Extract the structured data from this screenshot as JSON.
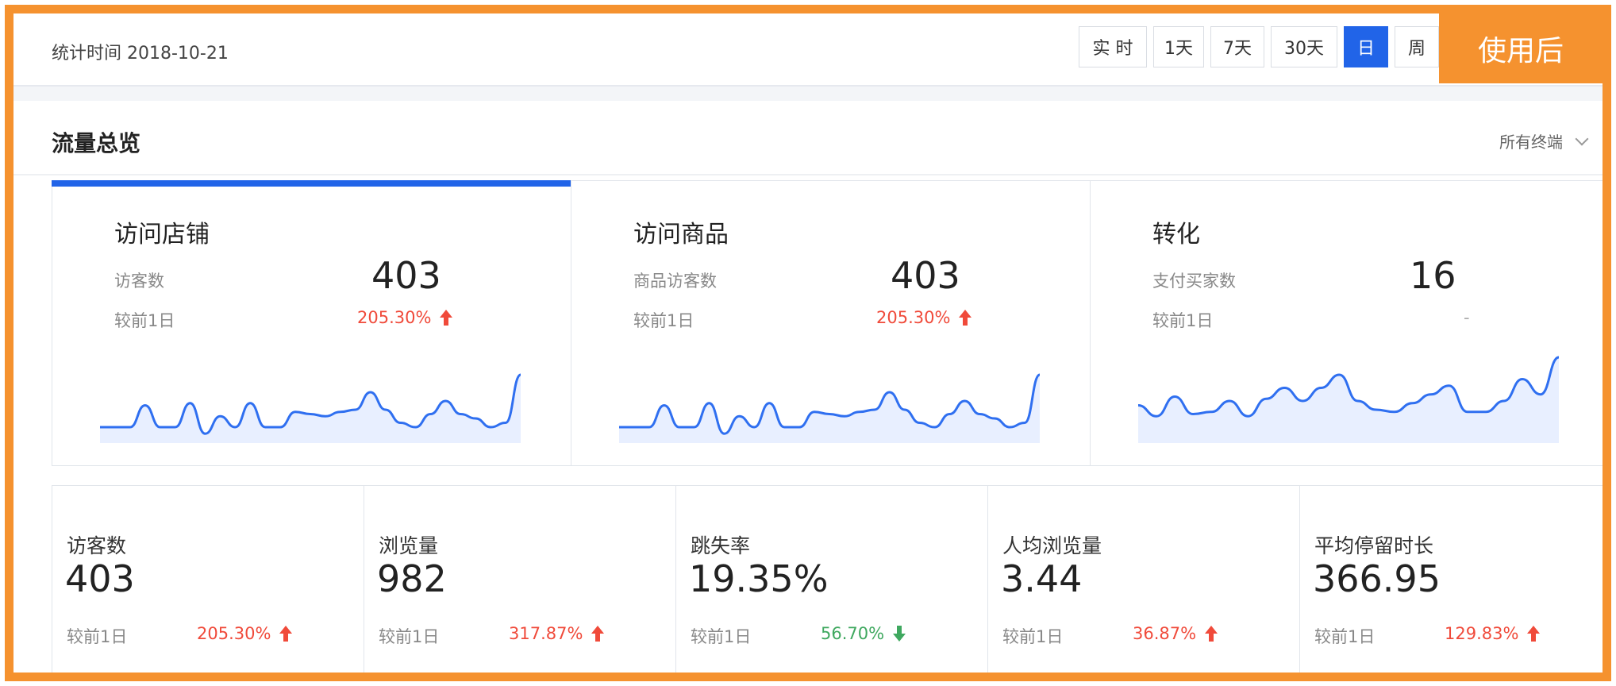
{
  "badge": "使用后",
  "header": {
    "stat_time": "统计时间 2018-10-21",
    "ranges": [
      {
        "label": "实 时",
        "active": false
      },
      {
        "label": "1天",
        "active": false
      },
      {
        "label": "7天",
        "active": false
      },
      {
        "label": "30天",
        "active": false
      },
      {
        "label": "日",
        "active": true
      },
      {
        "label": "周",
        "active": false
      }
    ]
  },
  "panel": {
    "title": "流量总览",
    "terminal_select": "所有终端"
  },
  "cards": [
    {
      "title": "访问店铺",
      "metric_label": "访客数",
      "metric_value": "403",
      "compare_label": "较前1日",
      "change": "205.30%",
      "trend": "up",
      "spark": [
        0,
        0,
        0,
        0.5,
        0,
        0,
        0.55,
        -0.15,
        0.25,
        0,
        0.55,
        0,
        0,
        0.35,
        0.3,
        0.25,
        0.35,
        0.4,
        0.8,
        0.4,
        0.1,
        0,
        0.3,
        0.6,
        0.3,
        0.2,
        0,
        0.1,
        1.2
      ]
    },
    {
      "title": "访问商品",
      "metric_label": "商品访客数",
      "metric_value": "403",
      "compare_label": "较前1日",
      "change": "205.30%",
      "trend": "up",
      "spark": [
        0,
        0,
        0,
        0.5,
        0,
        0,
        0.55,
        -0.15,
        0.25,
        0,
        0.55,
        0,
        0,
        0.35,
        0.3,
        0.25,
        0.35,
        0.4,
        0.8,
        0.4,
        0.1,
        0,
        0.3,
        0.6,
        0.3,
        0.2,
        0,
        0.1,
        1.2
      ]
    },
    {
      "title": "转化",
      "metric_label": "支付买家数",
      "metric_value": "16",
      "compare_label": "较前1日",
      "change": "-",
      "trend": "flat",
      "spark": [
        0.5,
        0.25,
        0.7,
        0.3,
        0.35,
        0.6,
        0.25,
        0.65,
        0.9,
        0.6,
        0.9,
        1.2,
        0.6,
        0.4,
        0.35,
        0.55,
        0.75,
        0.95,
        0.35,
        0.35,
        0.6,
        1.1,
        0.75,
        1.6
      ]
    }
  ],
  "kpis": [
    {
      "label": "访客数",
      "value": "403",
      "compare_label": "较前1日",
      "change": "205.30%",
      "trend": "up"
    },
    {
      "label": "浏览量",
      "value": "982",
      "compare_label": "较前1日",
      "change": "317.87%",
      "trend": "up"
    },
    {
      "label": "跳失率",
      "value": "19.35%",
      "compare_label": "较前1日",
      "change": "56.70%",
      "trend": "down"
    },
    {
      "label": "人均浏览量",
      "value": "3.44",
      "compare_label": "较前1日",
      "change": "36.87%",
      "trend": "up"
    },
    {
      "label": "平均停留时长",
      "value": "366.95",
      "compare_label": "较前1日",
      "change": "129.83%",
      "trend": "up"
    }
  ],
  "colors": {
    "accent": "#2164e8",
    "badge": "#f5922f",
    "up": "#f04a3a",
    "down": "#3fa85f",
    "spark_line": "#2f6ff0",
    "spark_fill": "#e8efff"
  }
}
